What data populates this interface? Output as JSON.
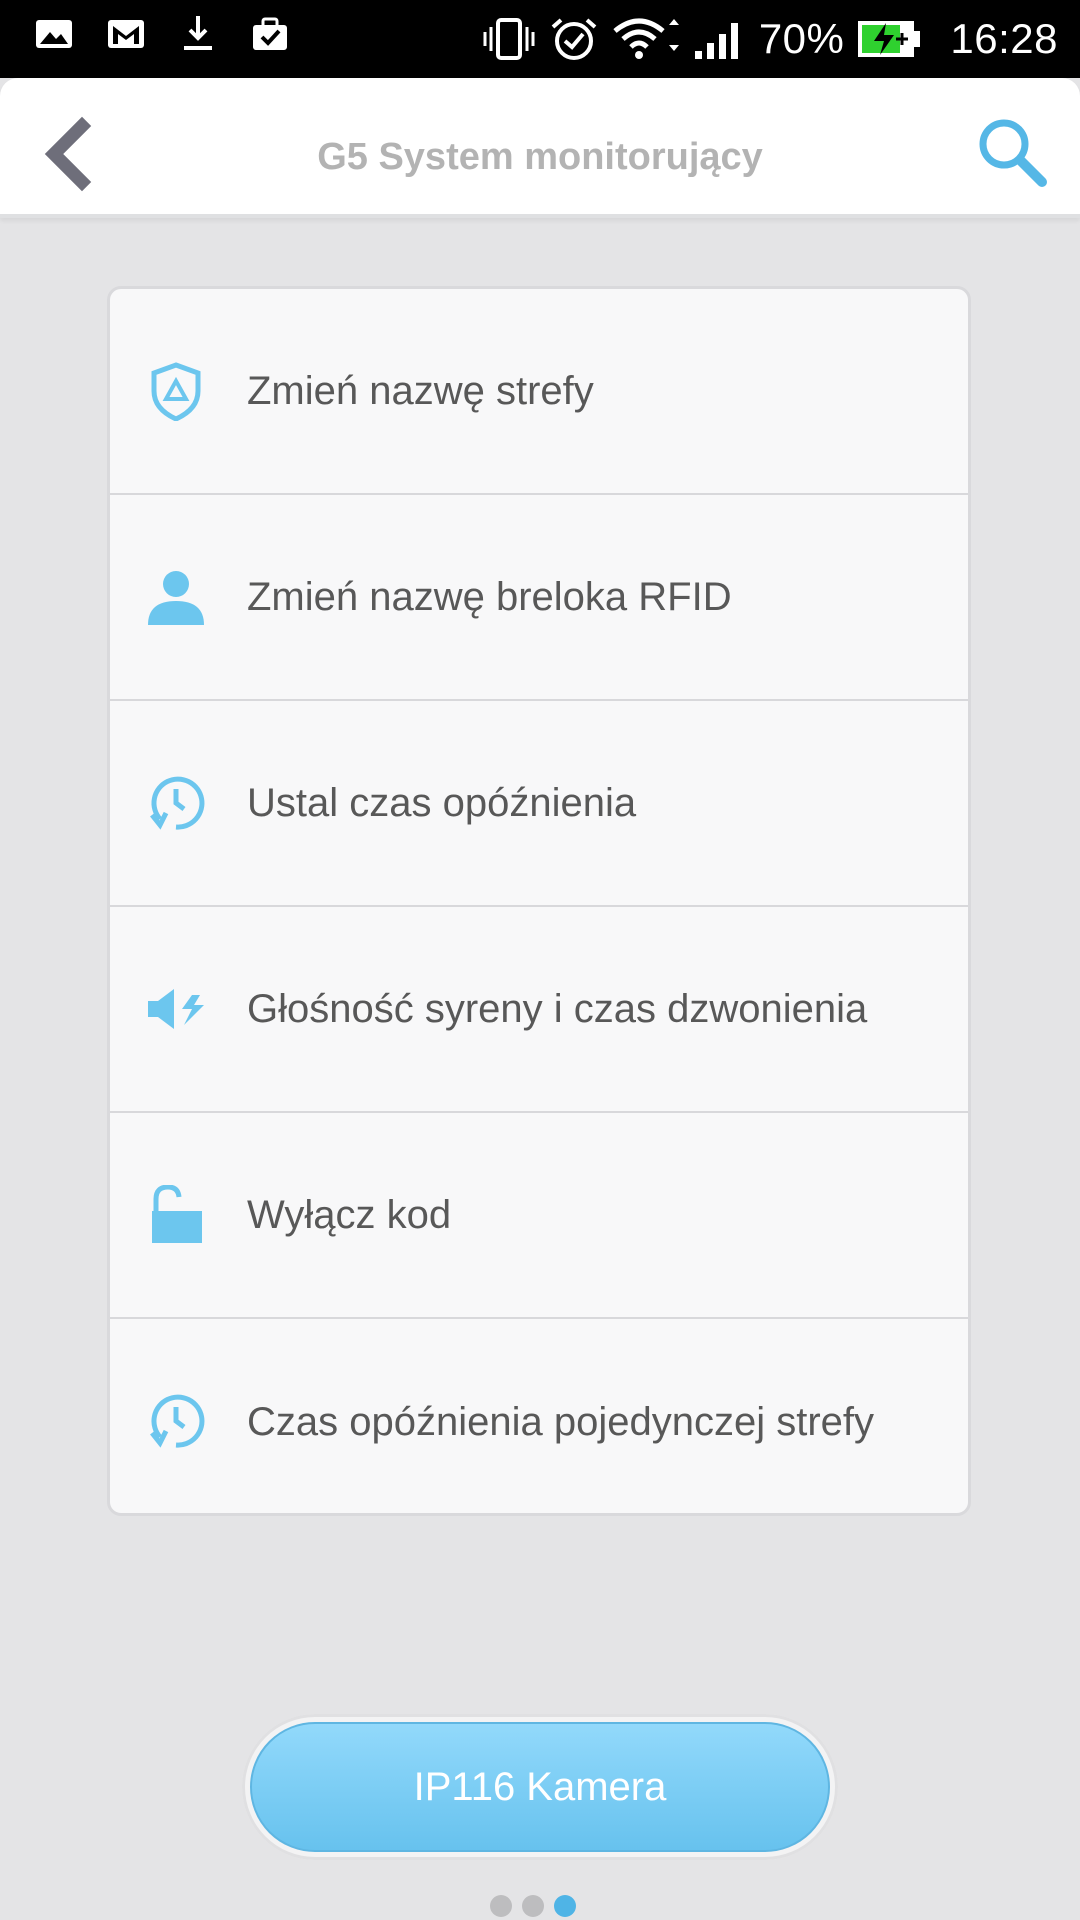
{
  "status_bar": {
    "battery_percent": "70%",
    "time": "16:28",
    "left_icons": [
      "gallery-icon",
      "gmail-icon",
      "download-icon",
      "briefcase-icon"
    ],
    "right_icons": [
      "vibrate-icon",
      "alarm-icon",
      "wifi-icon",
      "signal-icon",
      "battery-charging-icon"
    ]
  },
  "header": {
    "title": "G5 System monitorujący",
    "back_icon": "chevron-left-icon",
    "search_icon": "search-icon"
  },
  "menu": {
    "items": [
      {
        "label": "Zmień nazwę strefy",
        "icon": "shield-icon"
      },
      {
        "label": "Zmień nazwę breloka RFID",
        "icon": "user-icon"
      },
      {
        "label": "Ustal czas opóźnienia",
        "icon": "clock-delay-icon"
      },
      {
        "label": "Głośność syreny i czas dzwonienia",
        "icon": "speaker-icon"
      },
      {
        "label": "Wyłącz kod",
        "icon": "unlock-icon"
      },
      {
        "label": "Czas opóźnienia pojedynczej strefy",
        "icon": "clock-delay-icon"
      }
    ]
  },
  "bottom_button": {
    "label": "IP116 Kamera"
  },
  "pager": {
    "count": 3,
    "active_index": 2
  },
  "colors": {
    "accent": "#5ec0ee",
    "icon": "#6cc6ee",
    "label": "#585858",
    "title": "#b3b3b3"
  }
}
